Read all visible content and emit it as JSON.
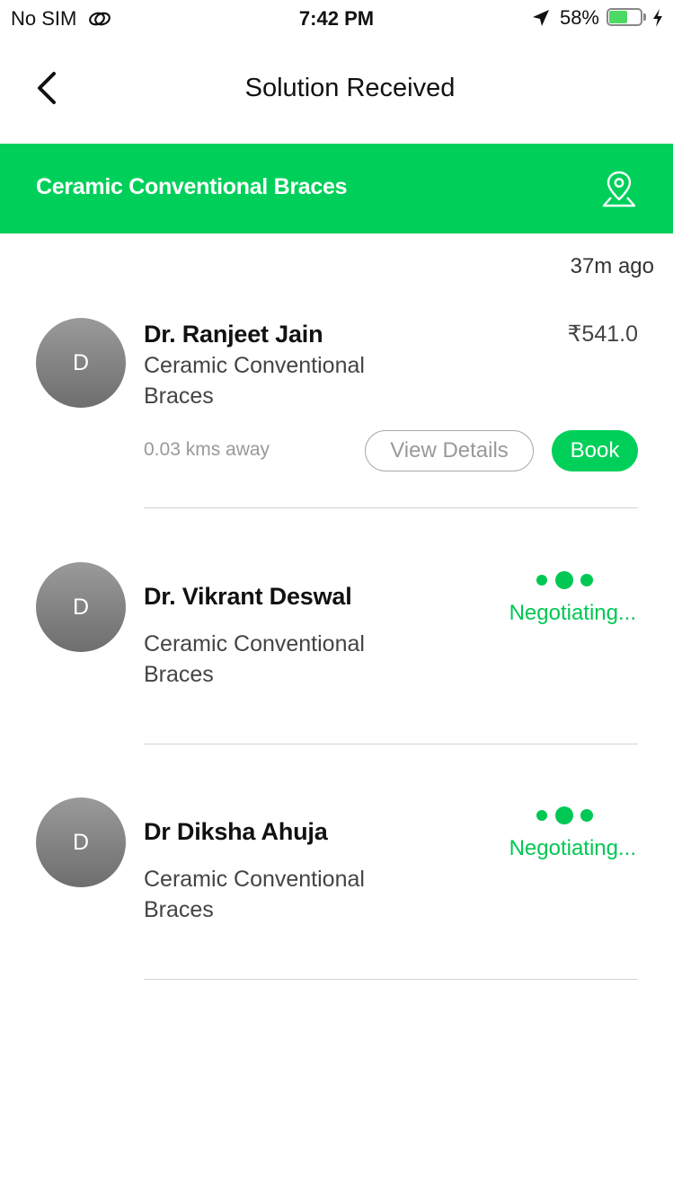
{
  "status_bar": {
    "carrier": "No SIM",
    "time": "7:42 PM",
    "battery_percent": "58%",
    "battery_level": 0.58
  },
  "header": {
    "title": "Solution Received"
  },
  "banner": {
    "title": "Ceramic Conventional Braces",
    "accent_color": "#00d05a"
  },
  "timestamp": "37m ago",
  "doctors": [
    {
      "initial": "D",
      "name": "Dr. Ranjeet Jain",
      "treatment": "Ceramic Conventional Braces",
      "price": "₹541.0",
      "distance": "0.03 kms away",
      "view_details_label": "View Details",
      "book_label": "Book"
    },
    {
      "initial": "D",
      "name": "Dr. Vikrant Deswal",
      "treatment": "Ceramic Conventional Braces",
      "status": "Negotiating..."
    },
    {
      "initial": "D",
      "name": "Dr Diksha Ahuja",
      "treatment": "Ceramic Conventional Braces",
      "status": "Negotiating..."
    }
  ]
}
